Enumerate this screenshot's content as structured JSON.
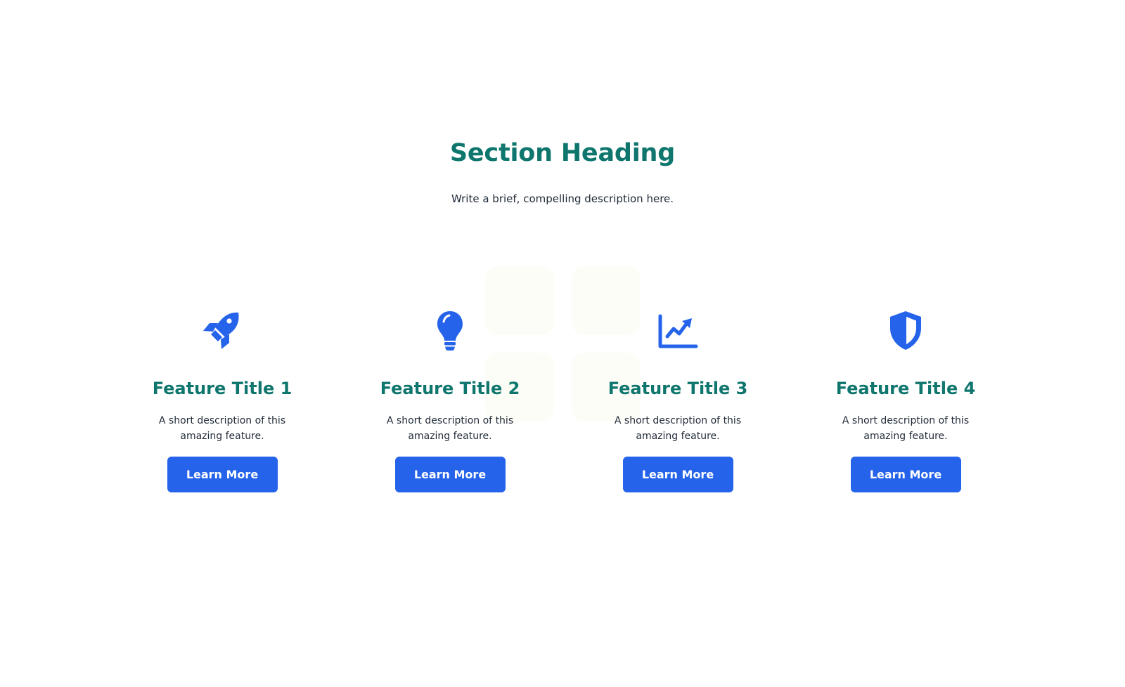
{
  "section": {
    "heading": "Section Heading",
    "description": "Write a brief, compelling description here."
  },
  "colors": {
    "accent_teal": "#0f766e",
    "primary_blue": "#2563eb",
    "text_dark": "#1f2937"
  },
  "features": [
    {
      "icon": "rocket-icon",
      "title": "Feature Title 1",
      "description": "A short description of this amazing feature.",
      "button_label": "Learn More"
    },
    {
      "icon": "lightbulb-icon",
      "title": "Feature Title 2",
      "description": "A short description of this amazing feature.",
      "button_label": "Learn More"
    },
    {
      "icon": "chart-line-icon",
      "title": "Feature Title 3",
      "description": "A short description of this amazing feature.",
      "button_label": "Learn More"
    },
    {
      "icon": "shield-icon",
      "title": "Feature Title 4",
      "description": "A short description of this amazing feature.",
      "button_label": "Learn More"
    }
  ]
}
